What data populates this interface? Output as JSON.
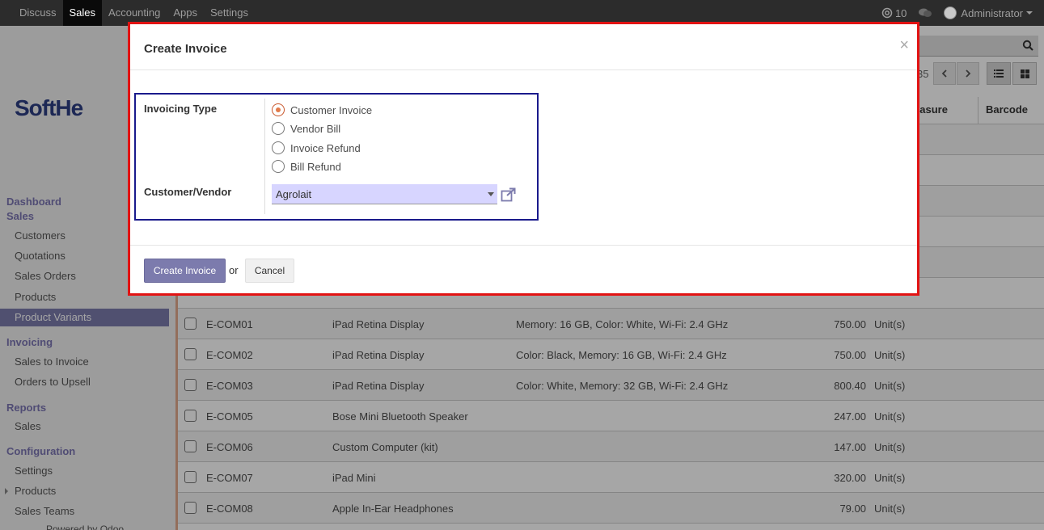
{
  "navbar": {
    "menu": [
      {
        "label": "Discuss",
        "active": false
      },
      {
        "label": "Sales",
        "active": true
      },
      {
        "label": "Accounting",
        "active": false
      },
      {
        "label": "Apps",
        "active": false
      },
      {
        "label": "Settings",
        "active": false
      }
    ],
    "messages_count": "10",
    "user_name": "Administrator"
  },
  "control_panel": {
    "pager_value": "35"
  },
  "sidebar": {
    "logo_text": "SoftHe",
    "sections": [
      {
        "heading": "Dashboard"
      },
      {
        "heading": "Sales",
        "items": [
          "Customers",
          "Quotations",
          "Sales Orders",
          "Products",
          "Product Variants"
        ]
      },
      {
        "heading": "Invoicing",
        "items": [
          "Sales to Invoice",
          "Orders to Upsell"
        ]
      },
      {
        "heading": "Reports",
        "items": [
          "Sales"
        ]
      },
      {
        "heading": "Configuration",
        "items": [
          "Settings",
          "Products",
          "Sales Teams"
        ]
      }
    ],
    "active_item": "Product Variants",
    "powered_by": "Powered by Odoo"
  },
  "list": {
    "columns": [
      "easure",
      "Barcode"
    ],
    "rows": [
      {
        "ref": "E-COM01",
        "name": "iPad Retina Display",
        "attributes": "Memory: 16 GB, Color: White, Wi-Fi: 2.4 GHz",
        "price": "750.00",
        "uom": "Unit(s)"
      },
      {
        "ref": "E-COM02",
        "name": "iPad Retina Display",
        "attributes": "Color: Black, Memory: 16 GB, Wi-Fi: 2.4 GHz",
        "price": "750.00",
        "uom": "Unit(s)"
      },
      {
        "ref": "E-COM03",
        "name": "iPad Retina Display",
        "attributes": "Color: White, Memory: 32 GB, Wi-Fi: 2.4 GHz",
        "price": "800.40",
        "uom": "Unit(s)"
      },
      {
        "ref": "E-COM05",
        "name": "Bose Mini Bluetooth Speaker",
        "attributes": "",
        "price": "247.00",
        "uom": "Unit(s)"
      },
      {
        "ref": "E-COM06",
        "name": "Custom Computer (kit)",
        "attributes": "",
        "price": "147.00",
        "uom": "Unit(s)"
      },
      {
        "ref": "E-COM07",
        "name": "iPad Mini",
        "attributes": "",
        "price": "320.00",
        "uom": "Unit(s)"
      },
      {
        "ref": "E-COM08",
        "name": "Apple In-Ear Headphones",
        "attributes": "",
        "price": "79.00",
        "uom": "Unit(s)"
      }
    ]
  },
  "modal": {
    "title": "Create Invoice",
    "close_glyph": "×",
    "invoicing_type_label": "Invoicing Type",
    "invoicing_types": [
      {
        "label": "Customer Invoice",
        "checked": true
      },
      {
        "label": "Vendor Bill",
        "checked": false
      },
      {
        "label": "Invoice Refund",
        "checked": false
      },
      {
        "label": "Bill Refund",
        "checked": false
      }
    ],
    "partner_label": "Customer/Vendor",
    "partner_value": "Agrolait",
    "submit_label": "Create Invoice",
    "or_text": "or",
    "cancel_label": "Cancel"
  },
  "colors": {
    "accent": "#7c7bad",
    "highlight_border": "#e21313",
    "form_border": "#1a1a8c",
    "select_bg": "#d7d5ff"
  }
}
